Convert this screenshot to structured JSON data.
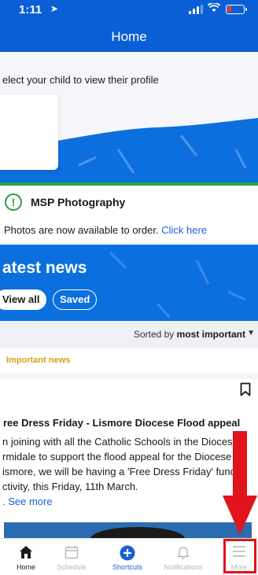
{
  "status_bar": {
    "time": "1:11",
    "battery_color": "#ff3b30"
  },
  "header": {
    "title": "Home",
    "bg_color": "#0b5fd6"
  },
  "profile": {
    "prompt": "elect your child to view their profile"
  },
  "alert": {
    "title": "MSP Photography",
    "body": "Photos are now available to order.",
    "link": "Click here",
    "icon_color": "#2f9e44"
  },
  "news": {
    "title": "atest news",
    "view_all": "View all",
    "saved": "Saved",
    "bg_color": "#0b6fde"
  },
  "sort": {
    "label": "Sorted by",
    "value": "most important"
  },
  "post": {
    "tag": "Important news",
    "tag_color": "#d4a017",
    "title": "ree Dress Friday - Lismore Diocese Flood appeal",
    "lines": [
      "n joining with all the Catholic Schools in the Diocese",
      "rmidale to support the flood appeal for the Diocese",
      "ismore, we will be having a 'Free Dress Friday' fundr",
      "ctivity, this Friday, 11th March."
    ],
    "see_more": ". See more"
  },
  "tabs": [
    {
      "label": "Home",
      "icon": "home-icon"
    },
    {
      "label": "Schedule",
      "icon": "calendar-icon"
    },
    {
      "label": "Shortcuts",
      "icon": "plus-circle-icon"
    },
    {
      "label": "Notifications",
      "icon": "bell-icon"
    },
    {
      "label": "More",
      "icon": "hamburger-icon"
    }
  ],
  "annotation_color": "#e0141a"
}
